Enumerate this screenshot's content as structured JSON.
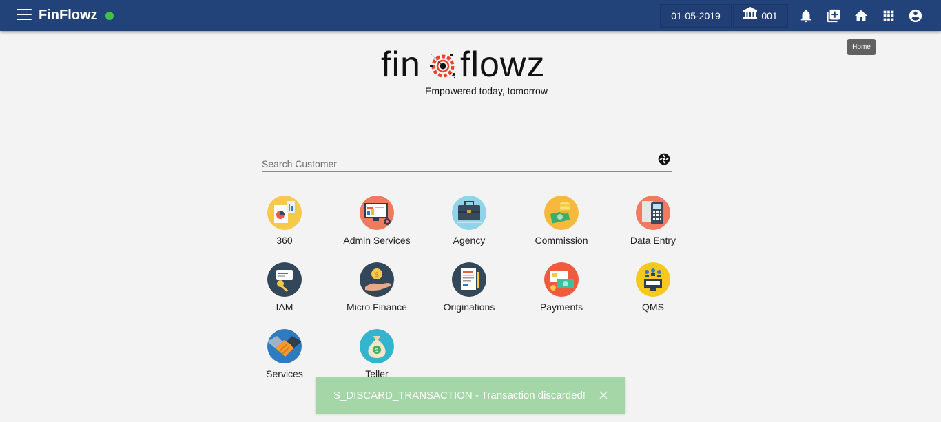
{
  "app": {
    "title": "FinFlowz",
    "status": "online"
  },
  "header": {
    "date": "01-05-2019",
    "branch": "001",
    "icons": [
      "menu-icon",
      "bank-icon",
      "bell-icon",
      "add-box-icon",
      "home-icon",
      "apps-grid-icon",
      "account-circle-icon"
    ]
  },
  "tooltip": {
    "text": "Home"
  },
  "logo": {
    "left_word": "fin",
    "right_word": "flowz",
    "tagline": "Empowered today, tomorrow"
  },
  "search": {
    "placeholder": "Search Customer",
    "value": ""
  },
  "modules": [
    {
      "label": "360",
      "icon": "report-icon",
      "color": "#f6c84c"
    },
    {
      "label": "Admin Services",
      "icon": "monitor-settings-icon",
      "color": "#f07a5e"
    },
    {
      "label": "Agency",
      "icon": "briefcase-icon",
      "color": "#8fd4e8"
    },
    {
      "label": "Commission",
      "icon": "coins-icon",
      "color": "#f6b93b"
    },
    {
      "label": "Data Entry",
      "icon": "calculator-icon",
      "color": "#f47a5f"
    },
    {
      "label": "IAM",
      "icon": "key-card-icon",
      "color": "#33475b"
    },
    {
      "label": "Micro Finance",
      "icon": "hand-coin-icon",
      "color": "#33475b"
    },
    {
      "label": "Originations",
      "icon": "document-pen-icon",
      "color": "#33475b"
    },
    {
      "label": "Payments",
      "icon": "card-cash-icon",
      "color": "#f05a3d"
    },
    {
      "label": "QMS",
      "icon": "queue-people-icon",
      "color": "#f7c81e"
    },
    {
      "label": "Services",
      "icon": "handshake-icon",
      "color": "#2e7bbf"
    },
    {
      "label": "Teller",
      "icon": "money-bag-icon",
      "color": "#33b5cf"
    }
  ],
  "toast": {
    "message": "S_DISCARD_TRANSACTION - Transaction discarded!"
  },
  "colors": {
    "header": "#22427a",
    "toast": "#a5d6a7",
    "status_dot": "#3fbf4b"
  }
}
